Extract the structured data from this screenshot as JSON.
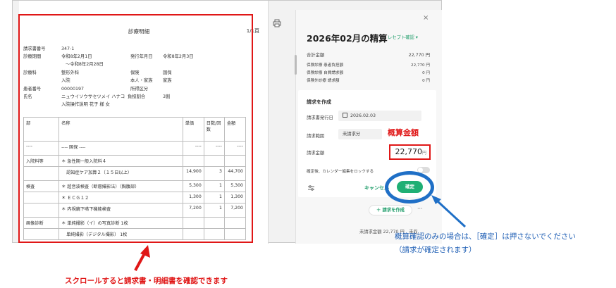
{
  "document": {
    "title": "診療明細",
    "page": "1/1頁",
    "fields": [
      {
        "label": "請求書番号",
        "value": "347-1"
      },
      {
        "label": "診療期間",
        "value": "令和8年2月1日",
        "value2": "〜令和8年2月28日",
        "label2": "発行年月日",
        "value3": "令和8年2月3日"
      },
      {
        "label": "診療科",
        "value": "整形外科",
        "value2": "入院",
        "label2": "保険",
        "value3": "国保",
        "label3": "本人・家族",
        "value4": "家族"
      },
      {
        "label": "患者番号",
        "value": "00000197",
        "label2": "所得区分"
      },
      {
        "label": "氏名",
        "value": "ニュウイソウサセツメイ ハナコ",
        "value2": "入院操作説明 花子 様 女",
        "label2": "負担割合",
        "value3": "3割"
      }
    ],
    "table": {
      "headers": [
        "部",
        "名称",
        "単価",
        "日数/回数",
        "金額"
      ],
      "rows": [
        {
          "section": "----",
          "name": "---- 国保 ----",
          "price": "----",
          "days": "----",
          "amount": "----"
        },
        {
          "section": "入院料等",
          "name": "＊ 急性期一般入院料４",
          "price": "",
          "days": "",
          "amount": ""
        },
        {
          "section": "",
          "name": "認知症ケア加算２（１５日以上）",
          "price": "14,900",
          "days": "3",
          "amount": "44,700",
          "sub": true
        },
        {
          "section": "検査",
          "name": "＊ 超音波検査（断層撮影法）（胸腹部）",
          "price": "5,300",
          "days": "1",
          "amount": "5,300"
        },
        {
          "section": "",
          "name": "＊ ＥＣＧ１２",
          "price": "1,300",
          "days": "1",
          "amount": "1,300"
        },
        {
          "section": "",
          "name": "＊ 内視鏡下嚥下機能検査",
          "price": "7,200",
          "days": "1",
          "amount": "7,200"
        },
        {
          "section": "画像診断",
          "name": "＊ 単純撮影（イ）の写真診断 1枚",
          "price": "",
          "days": "",
          "amount": ""
        },
        {
          "section": "",
          "name": "単純撮影（デジタル撮影） 1枚",
          "price": "",
          "days": "",
          "amount": "",
          "sub": true
        }
      ]
    }
  },
  "panel": {
    "title": "2026年02月の精算",
    "receipt_link": "レセプト確認 ▾",
    "summary": [
      {
        "label": "合計金額",
        "value": "22,770 円"
      },
      {
        "label": "保険診療 患者負担額",
        "value": "22,770 円"
      },
      {
        "label": "保険診療 自費請求額",
        "value": "0 円"
      },
      {
        "label": "保険外診療 請求額",
        "value": "0 円"
      }
    ],
    "create_title": "請求を作成",
    "issue_date_label": "請求書発行日",
    "issue_date_value": "2026.02.03",
    "range_label": "請求範囲",
    "range_value": "未請求分",
    "amount_label": "請求金額",
    "amount_value": "22,770",
    "amount_unit": "円",
    "lock_label": "確定後、カレンダー編集をロックする",
    "cancel": "キャンセル",
    "confirm": "確定",
    "add_invoice": "＋ 請求を作成",
    "more": "···",
    "footer": "未請求金額 22,770 円　未収"
  },
  "annotations": {
    "gaisan": "概算金額",
    "blue_note_line1": "概算確認のみの場合は、［確定］は押さないでください",
    "blue_note_line2": "（請求が確定されます）",
    "red_note": "スクロールすると請求書・明細書を確認できます"
  },
  "colors": {
    "accent_green": "#1faf74",
    "annotation_red": "#e01717",
    "annotation_blue": "#1f5fb5"
  }
}
